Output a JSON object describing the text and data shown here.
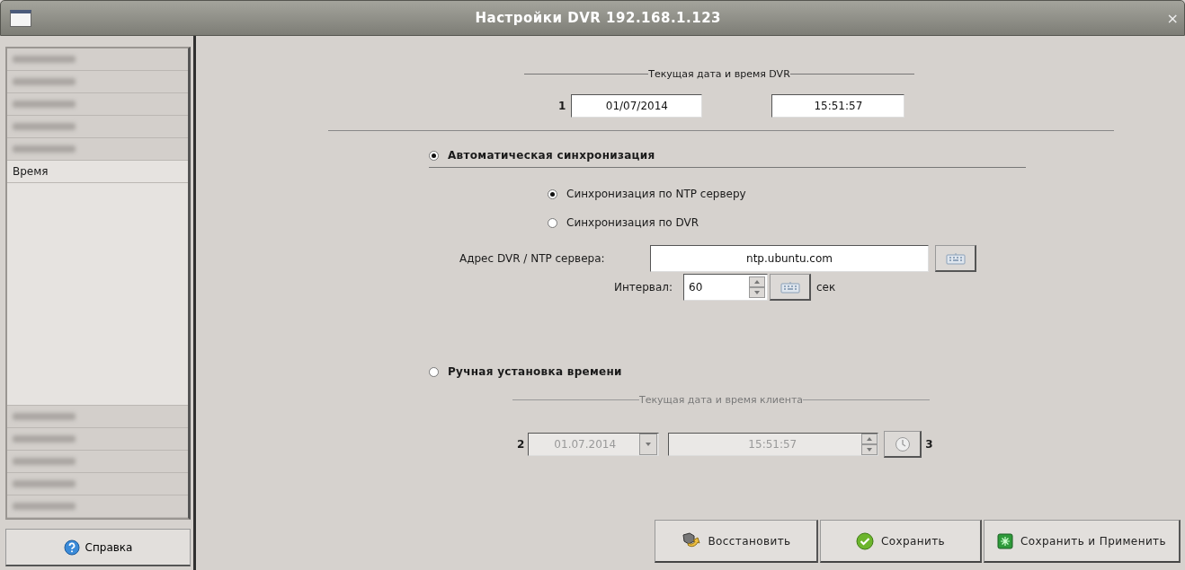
{
  "window": {
    "title": "Настройки DVR 192.168.1.123",
    "close": "×"
  },
  "sidebar": {
    "top_items": [
      {
        "redacted": true,
        "selected": false
      },
      {
        "redacted": true,
        "selected": false
      },
      {
        "redacted": true,
        "selected": false
      },
      {
        "redacted": true,
        "selected": false
      },
      {
        "redacted": true,
        "selected": false
      },
      {
        "redacted": false,
        "label": "Время",
        "selected": true
      }
    ],
    "bottom_items": [
      {
        "redacted": true,
        "selected": false
      },
      {
        "redacted": true,
        "selected": false
      },
      {
        "redacted": true,
        "selected": false
      },
      {
        "redacted": true,
        "selected": false
      },
      {
        "redacted": true,
        "selected": false
      }
    ],
    "help_button": {
      "label": "Справка"
    }
  },
  "dvr_time": {
    "title": "Текущая дата и время DVR",
    "marker": "1",
    "date": "01/07/2014",
    "time": "15:51:57"
  },
  "auto_sync": {
    "label": "Автоматическая синхронизация",
    "selected": true,
    "options": [
      {
        "label": "Синхронизация по NTP серверу",
        "selected": true
      },
      {
        "label": "Синхронизация по DVR",
        "selected": false
      }
    ],
    "address_label": "Адрес DVR / NTP сервера:",
    "address": "ntp.ubuntu.com",
    "interval_label": "Интервал:",
    "interval": "60",
    "interval_unit": "сек"
  },
  "manual": {
    "label": "Ручная установка времени",
    "selected": false,
    "disabled": true,
    "title": "Текущая дата и время клиента",
    "date_marker": "2",
    "date": "01.07.2014",
    "time": "15:51:57",
    "clock_marker": "3"
  },
  "buttons": [
    {
      "label": "Восстановить",
      "kind": "restore"
    },
    {
      "label": "Сохранить",
      "kind": "save"
    },
    {
      "label": "Сохранить и Применить",
      "kind": "apply"
    }
  ]
}
